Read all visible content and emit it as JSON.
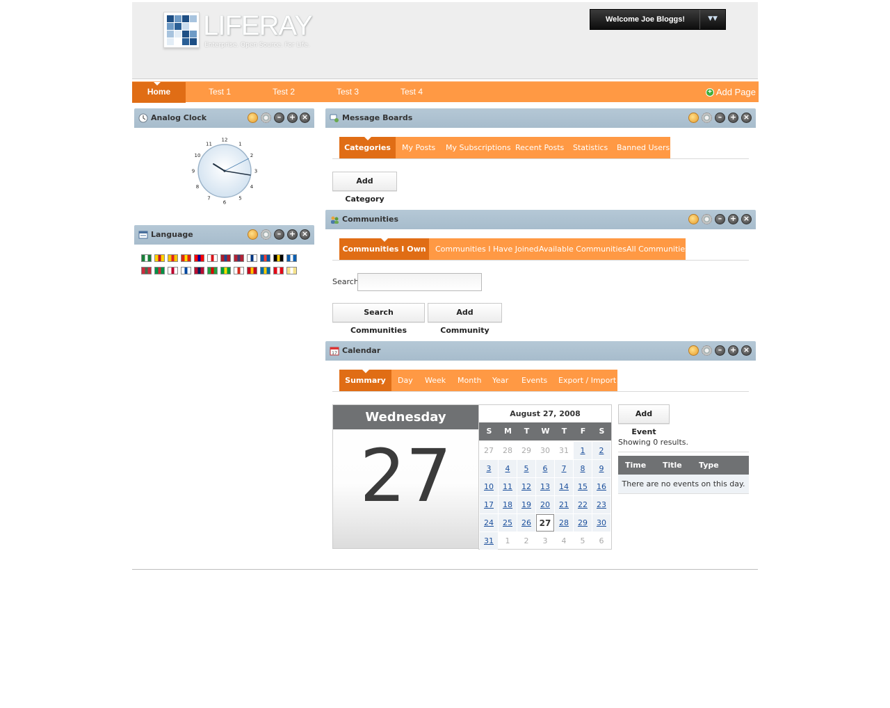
{
  "header": {
    "logo_word": "LIFERAY",
    "logo_tagline": "Enterprise. Open Source. For Life.",
    "welcome_label": "Welcome Joe Bloggs!",
    "dock_toggle_icon": "dock-arrow-icon"
  },
  "nav": {
    "tabs": [
      {
        "label": "Home",
        "selected": true
      },
      {
        "label": "Test 1"
      },
      {
        "label": "Test 2"
      },
      {
        "label": "Test 3"
      },
      {
        "label": "Test 4"
      }
    ],
    "add_page_label": "Add Page"
  },
  "portlets": {
    "analog_clock": {
      "title": "Analog Clock",
      "numerals": [
        "12",
        "1",
        "2",
        "3",
        "4",
        "5",
        "6",
        "7",
        "8",
        "9",
        "10",
        "11"
      ]
    },
    "language": {
      "title": "Language",
      "flags_row1": [
        "ar",
        "ca",
        "ca-es",
        "zh-cn",
        "zh-tw",
        "cs",
        "nl",
        "en",
        "fi",
        "fr",
        "de",
        "el"
      ],
      "flags_row2": [
        "hu",
        "it",
        "ja",
        "ko",
        "nb",
        "fa",
        "pt",
        "ru",
        "es",
        "sv",
        "tr",
        "vi"
      ]
    },
    "message_boards": {
      "title": "Message Boards",
      "tabs": [
        "Categories",
        "My Posts",
        "My Subscriptions",
        "Recent Posts",
        "Statistics",
        "Banned Users"
      ],
      "add_category_label": "Add Category"
    },
    "communities": {
      "title": "Communities",
      "tabs": [
        "Communities I Own",
        "Communities I Have Joined",
        "Available Communities",
        "All Communities"
      ],
      "search_label": "Search",
      "search_value": "",
      "search_button_label": "Search Communities",
      "add_button_label": "Add Community"
    },
    "calendar": {
      "title": "Calendar",
      "tabs": [
        "Summary",
        "Day",
        "Week",
        "Month",
        "Year",
        "Events",
        "Export / Import"
      ],
      "day_name": "Wednesday",
      "day_number": "27",
      "month_title": "August 27, 2008",
      "weekdays": [
        "S",
        "M",
        "T",
        "W",
        "T",
        "F",
        "S"
      ],
      "weeks": [
        [
          "27",
          "28",
          "29",
          "30",
          "31",
          "1",
          "2"
        ],
        [
          "3",
          "4",
          "5",
          "6",
          "7",
          "8",
          "9"
        ],
        [
          "10",
          "11",
          "12",
          "13",
          "14",
          "15",
          "16"
        ],
        [
          "17",
          "18",
          "19",
          "20",
          "21",
          "22",
          "23"
        ],
        [
          "24",
          "25",
          "26",
          "27",
          "28",
          "29",
          "30"
        ],
        [
          "31",
          "1",
          "2",
          "3",
          "4",
          "5",
          "6"
        ]
      ],
      "add_event_label": "Add Event",
      "results_text": "Showing 0 results.",
      "table_headers": [
        "Time",
        "Title",
        "Type"
      ],
      "empty_text": "There are no events on this day."
    }
  },
  "colors": {
    "nav_orange": "#ff9944",
    "nav_selected": "#e06d15",
    "portlet_title_bg": "#a7bccc",
    "calendar_header_gray": "#6f7173"
  }
}
